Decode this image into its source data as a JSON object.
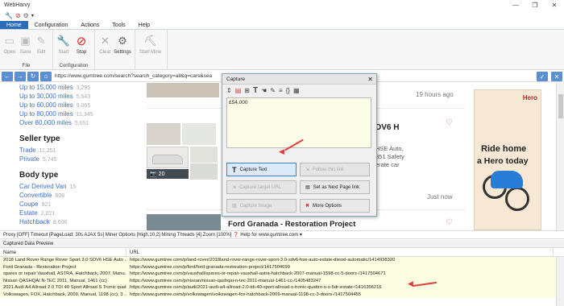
{
  "app": {
    "title": "WebHarvy"
  },
  "window": {
    "minimize": "—",
    "restore": "❐",
    "close": "✕"
  },
  "tabs": [
    "Home",
    "Configuration",
    "Actions",
    "Tools",
    "Help"
  ],
  "ribbon": {
    "file": {
      "name": "File",
      "open": "Open",
      "save": "Save",
      "edit": "Edit"
    },
    "configuration": {
      "name": "Configuration",
      "start": "Start",
      "stop": "Stop"
    },
    "settings": {
      "clear": "Clear",
      "settings": "Settings"
    },
    "mine": {
      "start_mine": "Start Mine"
    }
  },
  "address": {
    "url": "https://www.gumtree.com/search?search_category=all&q=cars&sea"
  },
  "sidebar": {
    "prices": [
      {
        "label": "Up to 15,000 miles",
        "count": "3,295"
      },
      {
        "label": "Up to 30,000 miles",
        "count": "5,543"
      },
      {
        "label": "Up to 60,000 miles",
        "count": "9,065"
      },
      {
        "label": "Up to 80,000 miles",
        "count": "11,345"
      },
      {
        "label": "Over 80,000 miles",
        "count": "5,651"
      }
    ],
    "seller_title": "Seller type",
    "seller": [
      {
        "label": "Trade",
        "count": "11,251"
      },
      {
        "label": "Private",
        "count": "5,745"
      }
    ],
    "body_title": "Body type",
    "body": [
      {
        "label": "Car Derived Van",
        "count": "15"
      },
      {
        "label": "Convertible",
        "count": "808"
      },
      {
        "label": "Coupe",
        "count": "921"
      },
      {
        "label": "Estate",
        "count": "2,021"
      },
      {
        "label": "Hatchback",
        "count": "8,606"
      }
    ]
  },
  "listing": {
    "time1": "19 hours ago",
    "title_frag": "DV6 H",
    "desc": [
      "HSE Auto,",
      "851 Safety",
      "erate car"
    ],
    "photo_count": "20",
    "time2": "Just now",
    "title2": "Ford Granada - Restoration Project"
  },
  "ad": {
    "brand": "Hero",
    "line1": "Ride home",
    "line2": "a Hero today"
  },
  "dialog": {
    "title": "Capture",
    "text": "£54,000",
    "buttons": {
      "capture_text": "Capture Text",
      "follow_link": "Follow this link",
      "capture_url": "Capture target URL",
      "next_page": "Set as Next Page link",
      "capture_image": "Capture Image",
      "more_options": "More Options"
    }
  },
  "status": {
    "text": "Proxy [OFF] Timeout [PageLoad: 30s AJAX 5s] Miner Options [High,10,2] Mining Threads [4] Zoom [100%]",
    "help": "Help for www.gumtree.com"
  },
  "preview": {
    "title": "Captured Data Preview",
    "columns": [
      "Name",
      "URL"
    ],
    "rows": [
      {
        "name": "2018 Land Rover Range Rover Sport 3.0 SDV6 HSE Auto ...",
        "url": "https://www.gumtree.com/p/land-rover/2018land-rover-range-rover-sport-3.0-sdv6-hse-auto-estate-diesel-automatic/1414938320"
      },
      {
        "name": "Ford Granada - Restoration Project",
        "url": "https://www.gumtree.com/p/ford/ford-granada-restoration-project/1417504699"
      },
      {
        "name": "spares or repair Vauxhall, ASTRA, Hatchback, 2007, Manu...",
        "url": "https://www.gumtree.com/p/vauxhall/spares-or-repair-vauxhall-astra-hatchback-2007-manual-1598-cc-5-doors-/1417504671"
      },
      {
        "name": "Nissan QASHQAI N-TEC 2011, Manual, 1461 (cc)",
        "url": "https://www.gumtree.com/p/nissan/nissan-qashqai-n-tec-2011-manual-1461-cc-/1405483247"
      },
      {
        "name": "2021 Audi A4 Allroad 2.0 TDI 40 Sport Allroad S Tronic quat...",
        "url": "https://www.gumtree.com/p/audi/2021-audi-a4-allroad-2.0-tdi-40-sport-allroad-s-tronic-quattro-s-s-5dr-estate-/1416356216"
      },
      {
        "name": "Volkswagen, FOX, Hatchback, 2009, Manual, 1198 (cc), 3 ...",
        "url": "https://www.gumtree.com/p/volkswagen/volkswagen-fox-hatchback-2009-manual-1198-cc-3-doors-/1417504455"
      }
    ]
  }
}
